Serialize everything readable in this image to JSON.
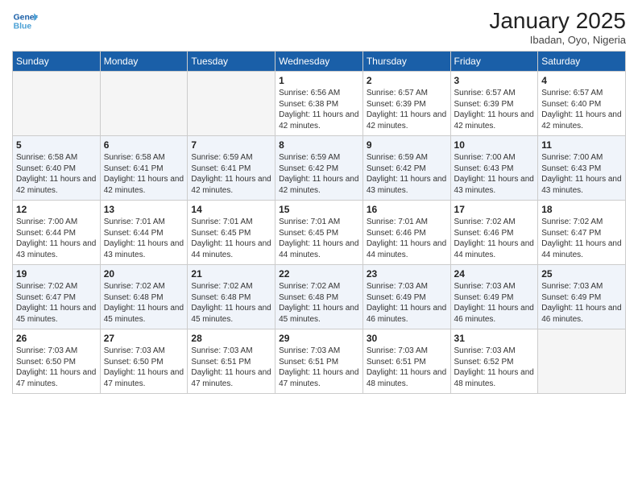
{
  "header": {
    "logo_line1": "General",
    "logo_line2": "Blue",
    "month": "January 2025",
    "location": "Ibadan, Oyo, Nigeria"
  },
  "days_of_week": [
    "Sunday",
    "Monday",
    "Tuesday",
    "Wednesday",
    "Thursday",
    "Friday",
    "Saturday"
  ],
  "weeks": [
    [
      {
        "day": "",
        "empty": true
      },
      {
        "day": "",
        "empty": true
      },
      {
        "day": "",
        "empty": true
      },
      {
        "day": "1",
        "sunrise": "6:56 AM",
        "sunset": "6:38 PM",
        "daylight": "11 hours and 42 minutes."
      },
      {
        "day": "2",
        "sunrise": "6:57 AM",
        "sunset": "6:39 PM",
        "daylight": "11 hours and 42 minutes."
      },
      {
        "day": "3",
        "sunrise": "6:57 AM",
        "sunset": "6:39 PM",
        "daylight": "11 hours and 42 minutes."
      },
      {
        "day": "4",
        "sunrise": "6:57 AM",
        "sunset": "6:40 PM",
        "daylight": "11 hours and 42 minutes."
      }
    ],
    [
      {
        "day": "5",
        "sunrise": "6:58 AM",
        "sunset": "6:40 PM",
        "daylight": "11 hours and 42 minutes."
      },
      {
        "day": "6",
        "sunrise": "6:58 AM",
        "sunset": "6:41 PM",
        "daylight": "11 hours and 42 minutes."
      },
      {
        "day": "7",
        "sunrise": "6:59 AM",
        "sunset": "6:41 PM",
        "daylight": "11 hours and 42 minutes."
      },
      {
        "day": "8",
        "sunrise": "6:59 AM",
        "sunset": "6:42 PM",
        "daylight": "11 hours and 42 minutes."
      },
      {
        "day": "9",
        "sunrise": "6:59 AM",
        "sunset": "6:42 PM",
        "daylight": "11 hours and 43 minutes."
      },
      {
        "day": "10",
        "sunrise": "7:00 AM",
        "sunset": "6:43 PM",
        "daylight": "11 hours and 43 minutes."
      },
      {
        "day": "11",
        "sunrise": "7:00 AM",
        "sunset": "6:43 PM",
        "daylight": "11 hours and 43 minutes."
      }
    ],
    [
      {
        "day": "12",
        "sunrise": "7:00 AM",
        "sunset": "6:44 PM",
        "daylight": "11 hours and 43 minutes."
      },
      {
        "day": "13",
        "sunrise": "7:01 AM",
        "sunset": "6:44 PM",
        "daylight": "11 hours and 43 minutes."
      },
      {
        "day": "14",
        "sunrise": "7:01 AM",
        "sunset": "6:45 PM",
        "daylight": "11 hours and 44 minutes."
      },
      {
        "day": "15",
        "sunrise": "7:01 AM",
        "sunset": "6:45 PM",
        "daylight": "11 hours and 44 minutes."
      },
      {
        "day": "16",
        "sunrise": "7:01 AM",
        "sunset": "6:46 PM",
        "daylight": "11 hours and 44 minutes."
      },
      {
        "day": "17",
        "sunrise": "7:02 AM",
        "sunset": "6:46 PM",
        "daylight": "11 hours and 44 minutes."
      },
      {
        "day": "18",
        "sunrise": "7:02 AM",
        "sunset": "6:47 PM",
        "daylight": "11 hours and 44 minutes."
      }
    ],
    [
      {
        "day": "19",
        "sunrise": "7:02 AM",
        "sunset": "6:47 PM",
        "daylight": "11 hours and 45 minutes."
      },
      {
        "day": "20",
        "sunrise": "7:02 AM",
        "sunset": "6:48 PM",
        "daylight": "11 hours and 45 minutes."
      },
      {
        "day": "21",
        "sunrise": "7:02 AM",
        "sunset": "6:48 PM",
        "daylight": "11 hours and 45 minutes."
      },
      {
        "day": "22",
        "sunrise": "7:02 AM",
        "sunset": "6:48 PM",
        "daylight": "11 hours and 45 minutes."
      },
      {
        "day": "23",
        "sunrise": "7:03 AM",
        "sunset": "6:49 PM",
        "daylight": "11 hours and 46 minutes."
      },
      {
        "day": "24",
        "sunrise": "7:03 AM",
        "sunset": "6:49 PM",
        "daylight": "11 hours and 46 minutes."
      },
      {
        "day": "25",
        "sunrise": "7:03 AM",
        "sunset": "6:49 PM",
        "daylight": "11 hours and 46 minutes."
      }
    ],
    [
      {
        "day": "26",
        "sunrise": "7:03 AM",
        "sunset": "6:50 PM",
        "daylight": "11 hours and 47 minutes."
      },
      {
        "day": "27",
        "sunrise": "7:03 AM",
        "sunset": "6:50 PM",
        "daylight": "11 hours and 47 minutes."
      },
      {
        "day": "28",
        "sunrise": "7:03 AM",
        "sunset": "6:51 PM",
        "daylight": "11 hours and 47 minutes."
      },
      {
        "day": "29",
        "sunrise": "7:03 AM",
        "sunset": "6:51 PM",
        "daylight": "11 hours and 47 minutes."
      },
      {
        "day": "30",
        "sunrise": "7:03 AM",
        "sunset": "6:51 PM",
        "daylight": "11 hours and 48 minutes."
      },
      {
        "day": "31",
        "sunrise": "7:03 AM",
        "sunset": "6:52 PM",
        "daylight": "11 hours and 48 minutes."
      },
      {
        "day": "",
        "empty": true
      }
    ]
  ]
}
